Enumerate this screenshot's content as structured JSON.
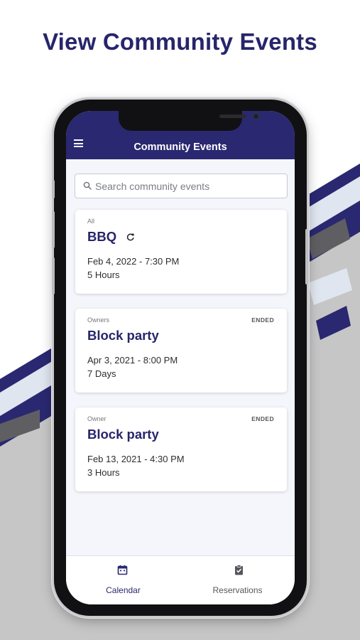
{
  "headline": "View Community Events",
  "app": {
    "title": "Community Events",
    "menu_icon": "hamburger-menu-icon"
  },
  "search": {
    "placeholder": "Search community events",
    "value": "",
    "icon": "search-icon"
  },
  "events": [
    {
      "category": "All",
      "title": "BBQ",
      "status": "",
      "recurring": true,
      "date": "Feb 4, 2022 - 7:30 PM",
      "duration": "5 Hours"
    },
    {
      "category": "Owners",
      "title": "Block party",
      "status": "ENDED",
      "recurring": false,
      "date": "Apr 3, 2021 - 8:00 PM",
      "duration": "7 Days"
    },
    {
      "category": "Owner",
      "title": "Block party",
      "status": "ENDED",
      "recurring": false,
      "date": "Feb 13, 2021 - 4:30 PM",
      "duration": "3 Hours"
    }
  ],
  "bottom_nav": [
    {
      "label": "Calendar",
      "icon": "calendar-icon",
      "active": true
    },
    {
      "label": "Reservations",
      "icon": "clipboard-check-icon",
      "active": false
    }
  ],
  "colors": {
    "brand_navy": "#2a2870",
    "title_navy": "#27256b",
    "screen_bg": "#f4f6fb",
    "accent_gray": "#5b5b60"
  }
}
